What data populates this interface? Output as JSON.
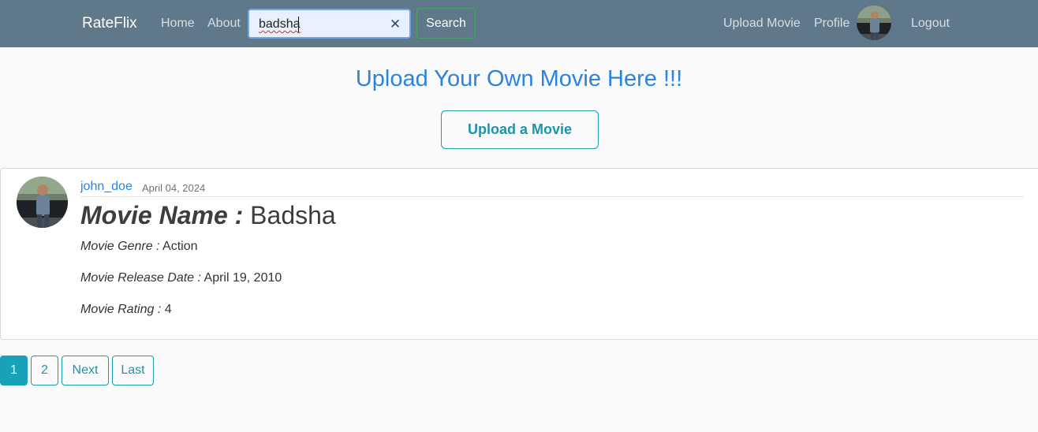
{
  "navbar": {
    "brand": "RateFlix",
    "links": {
      "home": "Home",
      "about": "About"
    },
    "search": {
      "value": "badsha",
      "button": "Search"
    },
    "right": {
      "upload": "Upload Movie",
      "profile": "Profile",
      "logout": "Logout"
    }
  },
  "upload": {
    "title": "Upload Your Own Movie Here !!!",
    "button": "Upload a Movie"
  },
  "post": {
    "author": "john_doe",
    "date": "April 04, 2024",
    "title_label": "Movie Name :",
    "title_value": "Badsha",
    "genre_label": "Movie Genre :",
    "genre_value": "Action",
    "release_label": "Movie Release Date :",
    "release_value": "April 19, 2010",
    "rating_label": "Movie Rating :",
    "rating_value": "4"
  },
  "pagination": {
    "page1": "1",
    "page2": "2",
    "next": "Next",
    "last": "Last"
  }
}
